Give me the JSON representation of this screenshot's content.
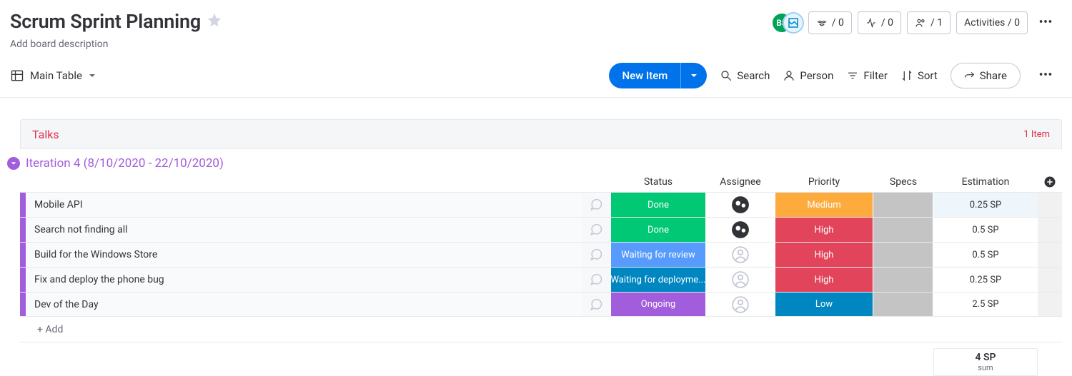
{
  "header": {
    "title": "Scrum Sprint Planning",
    "description": "Add board description",
    "avatars": {
      "a": "BS",
      "b": "⟳"
    },
    "integrations_count": "/ 0",
    "automations_count": "/ 0",
    "members": "/ 1",
    "activities": "Activities / 0"
  },
  "viewbar": {
    "view_name": "Main Table",
    "new_item": "New Item",
    "search": "Search",
    "person": "Person",
    "filter": "Filter",
    "sort": "Sort",
    "share": "Share"
  },
  "groups": {
    "talks": {
      "title": "Talks",
      "count": "1 Item"
    },
    "iteration": {
      "title": "Iteration 4 (8/10/2020 - 22/10/2020)",
      "columns": {
        "status": "Status",
        "assignee": "Assignee",
        "priority": "Priority",
        "specs": "Specs",
        "estimation": "Estimation"
      },
      "rows": [
        {
          "name": "Mobile API",
          "status": "Done",
          "status_class": "bg-done",
          "assignee": "filled",
          "priority": "Medium",
          "priority_class": "bg-med",
          "est": "0.25 SP",
          "est_class": ""
        },
        {
          "name": "Search not finding all",
          "status": "Done",
          "status_class": "bg-done",
          "assignee": "filled",
          "priority": "High",
          "priority_class": "bg-high",
          "est": "0.5 SP",
          "est_class": "plain"
        },
        {
          "name": "Build for the Windows Store",
          "status": "Waiting for review",
          "status_class": "bg-waitrev",
          "assignee": "empty",
          "priority": "High",
          "priority_class": "bg-high",
          "est": "0.5 SP",
          "est_class": "plain"
        },
        {
          "name": "Fix and deploy the phone bug",
          "status": "Waiting for deployme...",
          "status_class": "bg-waitdep",
          "assignee": "empty",
          "priority": "High",
          "priority_class": "bg-high",
          "est": "0.25 SP",
          "est_class": "plain"
        },
        {
          "name": "Dev of the Day",
          "status": "Ongoing",
          "status_class": "bg-ongoing",
          "assignee": "empty",
          "priority": "Low",
          "priority_class": "bg-low",
          "est": "2.5 SP",
          "est_class": "plain"
        }
      ],
      "add_row": "+ Add",
      "sum": {
        "value": "4 SP",
        "label": "sum"
      }
    }
  }
}
